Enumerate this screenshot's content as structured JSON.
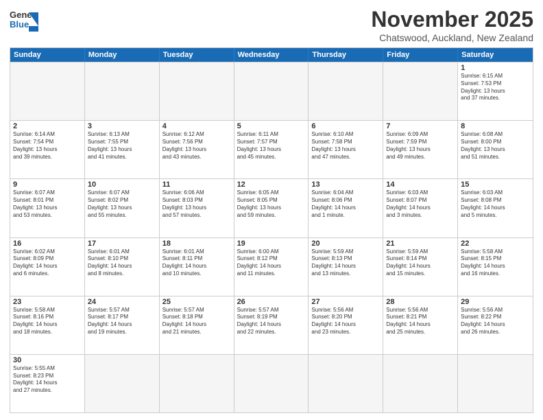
{
  "header": {
    "logo_general": "General",
    "logo_blue": "Blue",
    "title": "November 2025",
    "subtitle": "Chatswood, Auckland, New Zealand"
  },
  "weekdays": [
    "Sunday",
    "Monday",
    "Tuesday",
    "Wednesday",
    "Thursday",
    "Friday",
    "Saturday"
  ],
  "weeks": [
    [
      {
        "day": "",
        "info": ""
      },
      {
        "day": "",
        "info": ""
      },
      {
        "day": "",
        "info": ""
      },
      {
        "day": "",
        "info": ""
      },
      {
        "day": "",
        "info": ""
      },
      {
        "day": "",
        "info": ""
      },
      {
        "day": "1",
        "info": "Sunrise: 6:15 AM\nSunset: 7:53 PM\nDaylight: 13 hours\nand 37 minutes."
      }
    ],
    [
      {
        "day": "2",
        "info": "Sunrise: 6:14 AM\nSunset: 7:54 PM\nDaylight: 13 hours\nand 39 minutes."
      },
      {
        "day": "3",
        "info": "Sunrise: 6:13 AM\nSunset: 7:55 PM\nDaylight: 13 hours\nand 41 minutes."
      },
      {
        "day": "4",
        "info": "Sunrise: 6:12 AM\nSunset: 7:56 PM\nDaylight: 13 hours\nand 43 minutes."
      },
      {
        "day": "5",
        "info": "Sunrise: 6:11 AM\nSunset: 7:57 PM\nDaylight: 13 hours\nand 45 minutes."
      },
      {
        "day": "6",
        "info": "Sunrise: 6:10 AM\nSunset: 7:58 PM\nDaylight: 13 hours\nand 47 minutes."
      },
      {
        "day": "7",
        "info": "Sunrise: 6:09 AM\nSunset: 7:59 PM\nDaylight: 13 hours\nand 49 minutes."
      },
      {
        "day": "8",
        "info": "Sunrise: 6:08 AM\nSunset: 8:00 PM\nDaylight: 13 hours\nand 51 minutes."
      }
    ],
    [
      {
        "day": "9",
        "info": "Sunrise: 6:07 AM\nSunset: 8:01 PM\nDaylight: 13 hours\nand 53 minutes."
      },
      {
        "day": "10",
        "info": "Sunrise: 6:07 AM\nSunset: 8:02 PM\nDaylight: 13 hours\nand 55 minutes."
      },
      {
        "day": "11",
        "info": "Sunrise: 6:06 AM\nSunset: 8:03 PM\nDaylight: 13 hours\nand 57 minutes."
      },
      {
        "day": "12",
        "info": "Sunrise: 6:05 AM\nSunset: 8:05 PM\nDaylight: 13 hours\nand 59 minutes."
      },
      {
        "day": "13",
        "info": "Sunrise: 6:04 AM\nSunset: 8:06 PM\nDaylight: 14 hours\nand 1 minute."
      },
      {
        "day": "14",
        "info": "Sunrise: 6:03 AM\nSunset: 8:07 PM\nDaylight: 14 hours\nand 3 minutes."
      },
      {
        "day": "15",
        "info": "Sunrise: 6:03 AM\nSunset: 8:08 PM\nDaylight: 14 hours\nand 5 minutes."
      }
    ],
    [
      {
        "day": "16",
        "info": "Sunrise: 6:02 AM\nSunset: 8:09 PM\nDaylight: 14 hours\nand 6 minutes."
      },
      {
        "day": "17",
        "info": "Sunrise: 6:01 AM\nSunset: 8:10 PM\nDaylight: 14 hours\nand 8 minutes."
      },
      {
        "day": "18",
        "info": "Sunrise: 6:01 AM\nSunset: 8:11 PM\nDaylight: 14 hours\nand 10 minutes."
      },
      {
        "day": "19",
        "info": "Sunrise: 6:00 AM\nSunset: 8:12 PM\nDaylight: 14 hours\nand 11 minutes."
      },
      {
        "day": "20",
        "info": "Sunrise: 5:59 AM\nSunset: 8:13 PM\nDaylight: 14 hours\nand 13 minutes."
      },
      {
        "day": "21",
        "info": "Sunrise: 5:59 AM\nSunset: 8:14 PM\nDaylight: 14 hours\nand 15 minutes."
      },
      {
        "day": "22",
        "info": "Sunrise: 5:58 AM\nSunset: 8:15 PM\nDaylight: 14 hours\nand 16 minutes."
      }
    ],
    [
      {
        "day": "23",
        "info": "Sunrise: 5:58 AM\nSunset: 8:16 PM\nDaylight: 14 hours\nand 18 minutes."
      },
      {
        "day": "24",
        "info": "Sunrise: 5:57 AM\nSunset: 8:17 PM\nDaylight: 14 hours\nand 19 minutes."
      },
      {
        "day": "25",
        "info": "Sunrise: 5:57 AM\nSunset: 8:18 PM\nDaylight: 14 hours\nand 21 minutes."
      },
      {
        "day": "26",
        "info": "Sunrise: 5:57 AM\nSunset: 8:19 PM\nDaylight: 14 hours\nand 22 minutes."
      },
      {
        "day": "27",
        "info": "Sunrise: 5:56 AM\nSunset: 8:20 PM\nDaylight: 14 hours\nand 23 minutes."
      },
      {
        "day": "28",
        "info": "Sunrise: 5:56 AM\nSunset: 8:21 PM\nDaylight: 14 hours\nand 25 minutes."
      },
      {
        "day": "29",
        "info": "Sunrise: 5:56 AM\nSunset: 8:22 PM\nDaylight: 14 hours\nand 26 minutes."
      }
    ],
    [
      {
        "day": "30",
        "info": "Sunrise: 5:55 AM\nSunset: 8:23 PM\nDaylight: 14 hours\nand 27 minutes."
      },
      {
        "day": "",
        "info": ""
      },
      {
        "day": "",
        "info": ""
      },
      {
        "day": "",
        "info": ""
      },
      {
        "day": "",
        "info": ""
      },
      {
        "day": "",
        "info": ""
      },
      {
        "day": "",
        "info": ""
      }
    ]
  ]
}
